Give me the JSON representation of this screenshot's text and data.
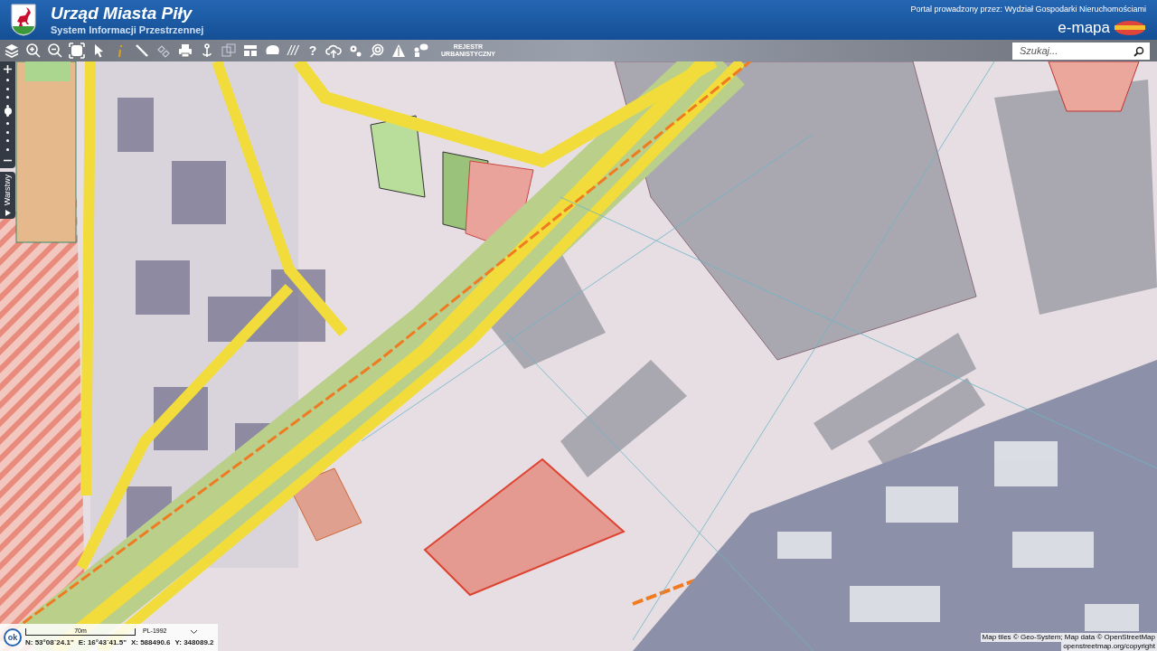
{
  "header": {
    "title": "Urząd Miasta Piły",
    "subtitle": "System Informacji Przestrzennej",
    "operator": "Portal prowadzony przez: Wydział Gospodarki Nieruchomościami",
    "brand": "e-mapa"
  },
  "toolbar": {
    "hatch_label": "///",
    "help_label": "?",
    "register_label": "REJESTR URBANISTYCZNY"
  },
  "search": {
    "placeholder": "Szukaj..."
  },
  "zoom_control": {
    "level": 0.55
  },
  "layers_tab": {
    "label": "Warstwy"
  },
  "status_panel": {
    "ok_label": "ok",
    "scale": "70m",
    "projection": "PL-1992",
    "coordinates": [
      "N: 53°08´24.1\"",
      "E: 16°43´41.5\"",
      "X: 588490.6",
      "Y: 348089.2"
    ]
  },
  "attribution": [
    "Map tiles © Geo-System; Map data © OpenStreetMap",
    "openstreetmap.org/copyright"
  ]
}
